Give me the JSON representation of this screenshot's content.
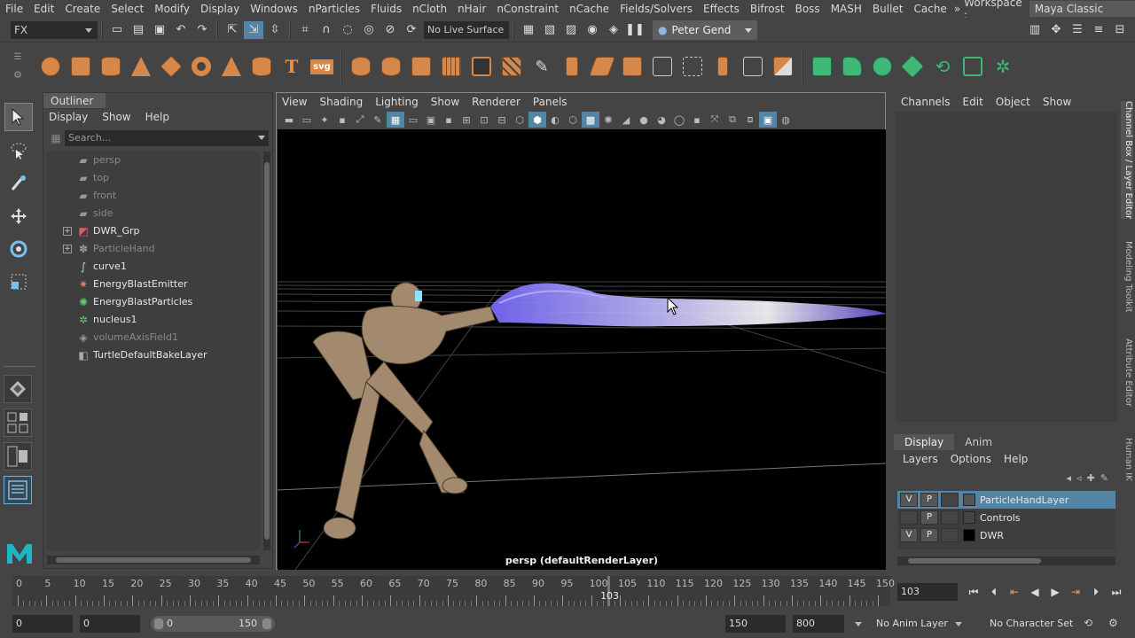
{
  "menubar": {
    "items": [
      "File",
      "Edit",
      "Create",
      "Select",
      "Modify",
      "Display",
      "Windows",
      "nParticles",
      "Fluids",
      "nCloth",
      "nHair",
      "nConstraint",
      "nCache",
      "Fields/Solvers",
      "Effects",
      "Bifrost",
      "Boss",
      "MASH",
      "Bullet",
      "Cache"
    ],
    "more_icon": "double-chevron-icon",
    "workspace_label": "Workspace :",
    "workspace_value": "Maya Classic"
  },
  "statusline": {
    "mode": "FX",
    "live_surface": "No Live Surface",
    "user": "Peter Gend"
  },
  "outliner": {
    "title": "Outliner",
    "menu": [
      "Display",
      "Show",
      "Help"
    ],
    "search_placeholder": "Search...",
    "nodes": [
      {
        "label": "persp",
        "icon": "camera-icon",
        "dim": true,
        "expandable": false
      },
      {
        "label": "top",
        "icon": "camera-icon",
        "dim": true,
        "expandable": false
      },
      {
        "label": "front",
        "icon": "camera-icon",
        "dim": true,
        "expandable": false
      },
      {
        "label": "side",
        "icon": "camera-icon",
        "dim": true,
        "expandable": false
      },
      {
        "label": "DWR_Grp",
        "icon": "group-icon",
        "dim": false,
        "expandable": true
      },
      {
        "label": "ParticleHand",
        "icon": "particle-icon",
        "dim": true,
        "expandable": true
      },
      {
        "label": "curve1",
        "icon": "curve-icon",
        "dim": false,
        "expandable": false
      },
      {
        "label": "EnergyBlastEmitter",
        "icon": "emitter-icon",
        "dim": false,
        "expandable": false
      },
      {
        "label": "EnergyBlastParticles",
        "icon": "nparticle-icon",
        "dim": false,
        "expandable": false
      },
      {
        "label": "nucleus1",
        "icon": "nucleus-icon",
        "dim": false,
        "expandable": false
      },
      {
        "label": "volumeAxisField1",
        "icon": "field-icon",
        "dim": true,
        "expandable": false
      },
      {
        "label": "TurtleDefaultBakeLayer",
        "icon": "bake-layer-icon",
        "dim": false,
        "expandable": false
      }
    ]
  },
  "viewport": {
    "menu": [
      "View",
      "Shading",
      "Lighting",
      "Show",
      "Renderer",
      "Panels"
    ],
    "caption": "persp (defaultRenderLayer)"
  },
  "channelbox": {
    "menu": [
      "Channels",
      "Edit",
      "Object",
      "Show"
    ]
  },
  "side_tabs": [
    "Channel Box / Layer Editor",
    "Modeling Toolkit",
    "Attribute Editor",
    "Human IK"
  ],
  "layer_editor": {
    "tabs": [
      "Display",
      "Anim"
    ],
    "menu": [
      "Layers",
      "Options",
      "Help"
    ],
    "layers": [
      {
        "v": "V",
        "p": "P",
        "name": "ParticleHandLayer",
        "selected": true,
        "color": "#555555"
      },
      {
        "v": "",
        "p": "P",
        "name": "Controls",
        "selected": false,
        "color": "#444444"
      },
      {
        "v": "V",
        "p": "P",
        "name": "DWR",
        "selected": false,
        "color": "#000000"
      }
    ]
  },
  "timeline": {
    "ticks": [
      "0",
      "5",
      "10",
      "15",
      "20",
      "25",
      "30",
      "35",
      "40",
      "45",
      "50",
      "55",
      "60",
      "65",
      "70",
      "75",
      "80",
      "85",
      "90",
      "95",
      "100",
      "105",
      "110",
      "115",
      "120",
      "125",
      "130",
      "135",
      "140",
      "145",
      "150"
    ],
    "current": "103",
    "current_field": "103"
  },
  "range": {
    "start": "0",
    "anim_start": "0",
    "slider_min": "0",
    "slider_max": "150",
    "end": "150",
    "anim_end": "800",
    "anim_layer": "No Anim Layer",
    "character_set": "No Character Set"
  },
  "colors": {
    "accent": "#5285a6",
    "shelf_orange": "#d6874a",
    "shelf_green": "#3fb878",
    "particle_blue": "#9a8cff"
  }
}
